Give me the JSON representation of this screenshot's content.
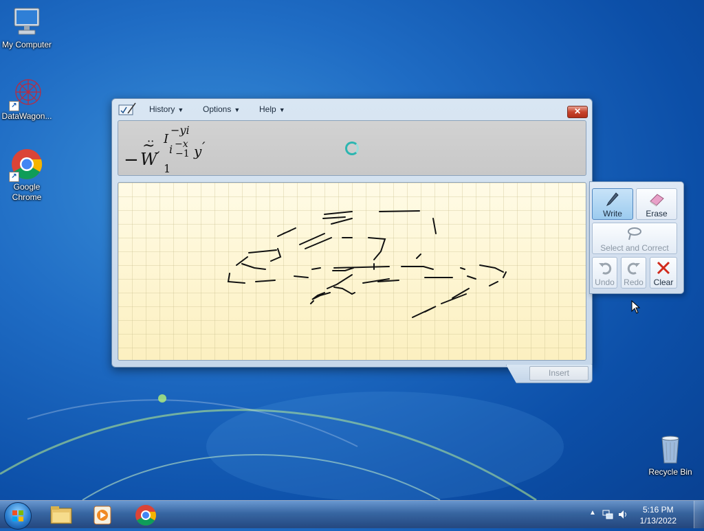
{
  "desktop": {
    "icons": [
      {
        "label": "My Computer",
        "icon": "computer-icon"
      },
      {
        "label": "DataWagon...",
        "icon": "datawagon-icon"
      },
      {
        "label": "Google Chrome",
        "icon": "chrome-icon"
      },
      {
        "label": "Recycle Bin",
        "icon": "recycle-bin-icon"
      }
    ]
  },
  "window": {
    "app_icon": "math-input-panel-icon",
    "menus": [
      {
        "label": "History"
      },
      {
        "label": "Options"
      },
      {
        "label": "Help"
      }
    ],
    "close_label": "✕",
    "preview": {
      "math": {
        "minus": "−",
        "w": "W",
        "w_prime": "′",
        "sup_I": "I",
        "sup_yi": "−yi",
        "sub_i": "i",
        "sub_x": "−x",
        "sub_1": "−1",
        "y": "y",
        "y_prime": "′",
        "bottom_1": "1",
        "dots": "··",
        "tilde": "~"
      }
    }
  },
  "tools": {
    "write": "Write",
    "erase": "Erase",
    "select_correct": "Select and Correct",
    "undo": "Undo",
    "redo": "Redo",
    "clear": "Clear"
  },
  "insert_label": "Insert",
  "taskbar": {
    "items": [
      "start-orb-icon",
      "file-explorer-icon",
      "media-player-icon",
      "chrome-icon"
    ],
    "clock_time": "5:16 PM",
    "clock_date": "1/13/2022"
  }
}
